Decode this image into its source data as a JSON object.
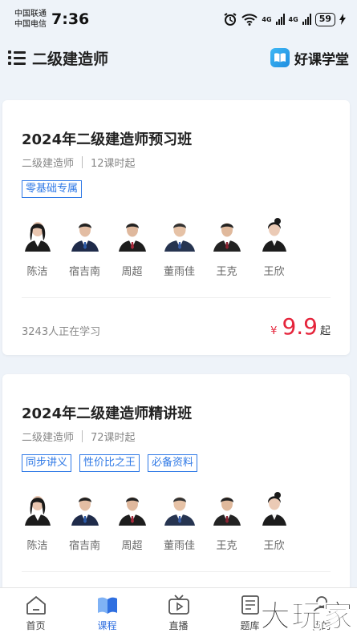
{
  "status_bar": {
    "carrier1": "中国联通",
    "carrier2": "中国电信",
    "time": "7:36",
    "battery": "59",
    "network1": "4G",
    "network2": "4G"
  },
  "header": {
    "title": "二级建造师",
    "brand": "好课学堂",
    "brand_color": "#1f8de0"
  },
  "courses": [
    {
      "title": "2024年二级建造师预习班",
      "category": "二级建造师",
      "lessons": "12课时起",
      "tags": [
        "零基础专属"
      ],
      "teachers": [
        "陈洁",
        "宿吉南",
        "周超",
        "董雨佳",
        "王克",
        "王欣"
      ],
      "learners": "3243人正在学习",
      "currency": "¥",
      "price": "9.9",
      "price_suffix": "起"
    },
    {
      "title": "2024年二级建造师精讲班",
      "category": "二级建造师",
      "lessons": "72课时起",
      "tags": [
        "同步讲义",
        "性价比之王",
        "必备资料"
      ],
      "teachers": [
        "陈洁",
        "宿吉南",
        "周超",
        "董雨佳",
        "王克",
        "王欣"
      ]
    }
  ],
  "tabbar": {
    "items": [
      {
        "label": "首页",
        "icon": "home-icon"
      },
      {
        "label": "课程",
        "icon": "book-icon",
        "active": true
      },
      {
        "label": "直播",
        "icon": "tv-icon"
      },
      {
        "label": "题库",
        "icon": "question-bank-icon"
      },
      {
        "label": "我的",
        "icon": "profile-icon"
      }
    ]
  },
  "watermark": "大玩家",
  "colors": {
    "accent": "#2f79e6",
    "price": "#e5243b",
    "active_tab": "#2f6fe0"
  }
}
